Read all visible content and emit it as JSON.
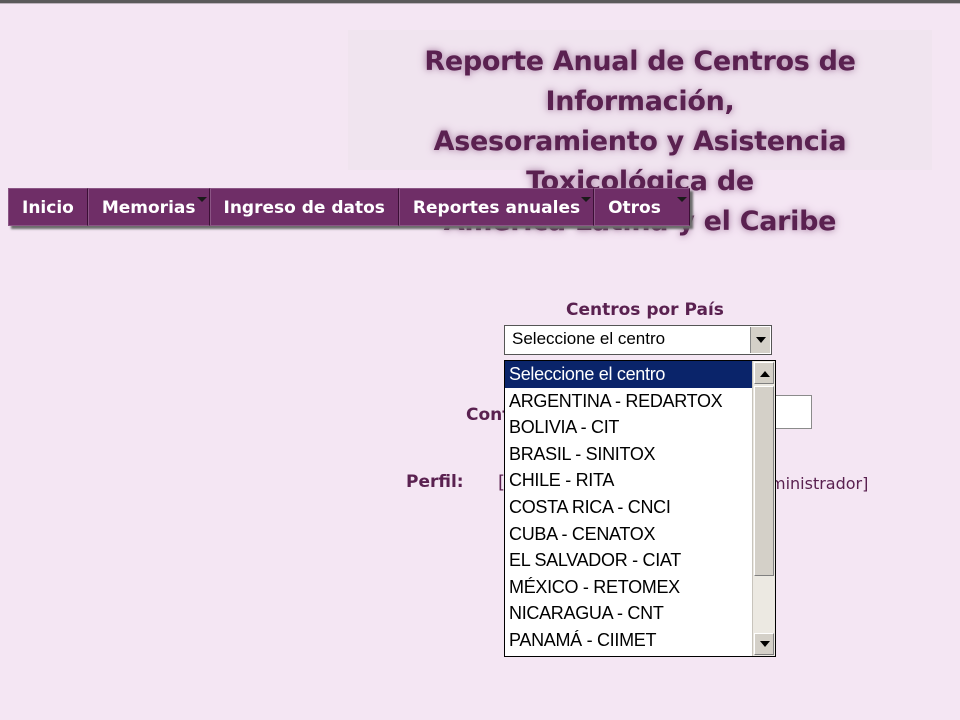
{
  "banner": {
    "line1": "Reporte Anual de Centros de Información,",
    "line2": "Asesoramiento y Asistencia Toxicológica de",
    "line3": "América Latina y el Caribe"
  },
  "menu": {
    "items": [
      {
        "label": "Inicio",
        "has_submenu": false
      },
      {
        "label": "Memorias",
        "has_submenu": true
      },
      {
        "label": "Ingreso de datos",
        "has_submenu": false
      },
      {
        "label": "Reportes anuales",
        "has_submenu": true
      },
      {
        "label": "Otros",
        "has_submenu": true
      }
    ]
  },
  "form": {
    "centros_label": "Centros por País",
    "select_value": "Seleccione el centro",
    "partial_label": "Cont",
    "perfil_label": "Perfil:",
    "perfil_left_bracket": "[",
    "perfil_right_text": "ministrador]"
  },
  "dropdown": {
    "options": [
      "Seleccione el centro",
      "ARGENTINA - REDARTOX",
      "BOLIVIA - CIT",
      "BRASIL - SINITOX",
      "CHILE - RITA",
      "COSTA RICA - CNCI",
      "CUBA - CENATOX",
      "EL SALVADOR - CIAT",
      "MÉXICO - RETOMEX",
      "NICARAGUA - CNT",
      "PANAMÁ - CIIMET"
    ],
    "selected_index": 0
  },
  "colors": {
    "background": "#f4e6f3",
    "menu_bg": "#6f2e67",
    "title_text": "#5a2150",
    "selection": "#0a246a"
  }
}
